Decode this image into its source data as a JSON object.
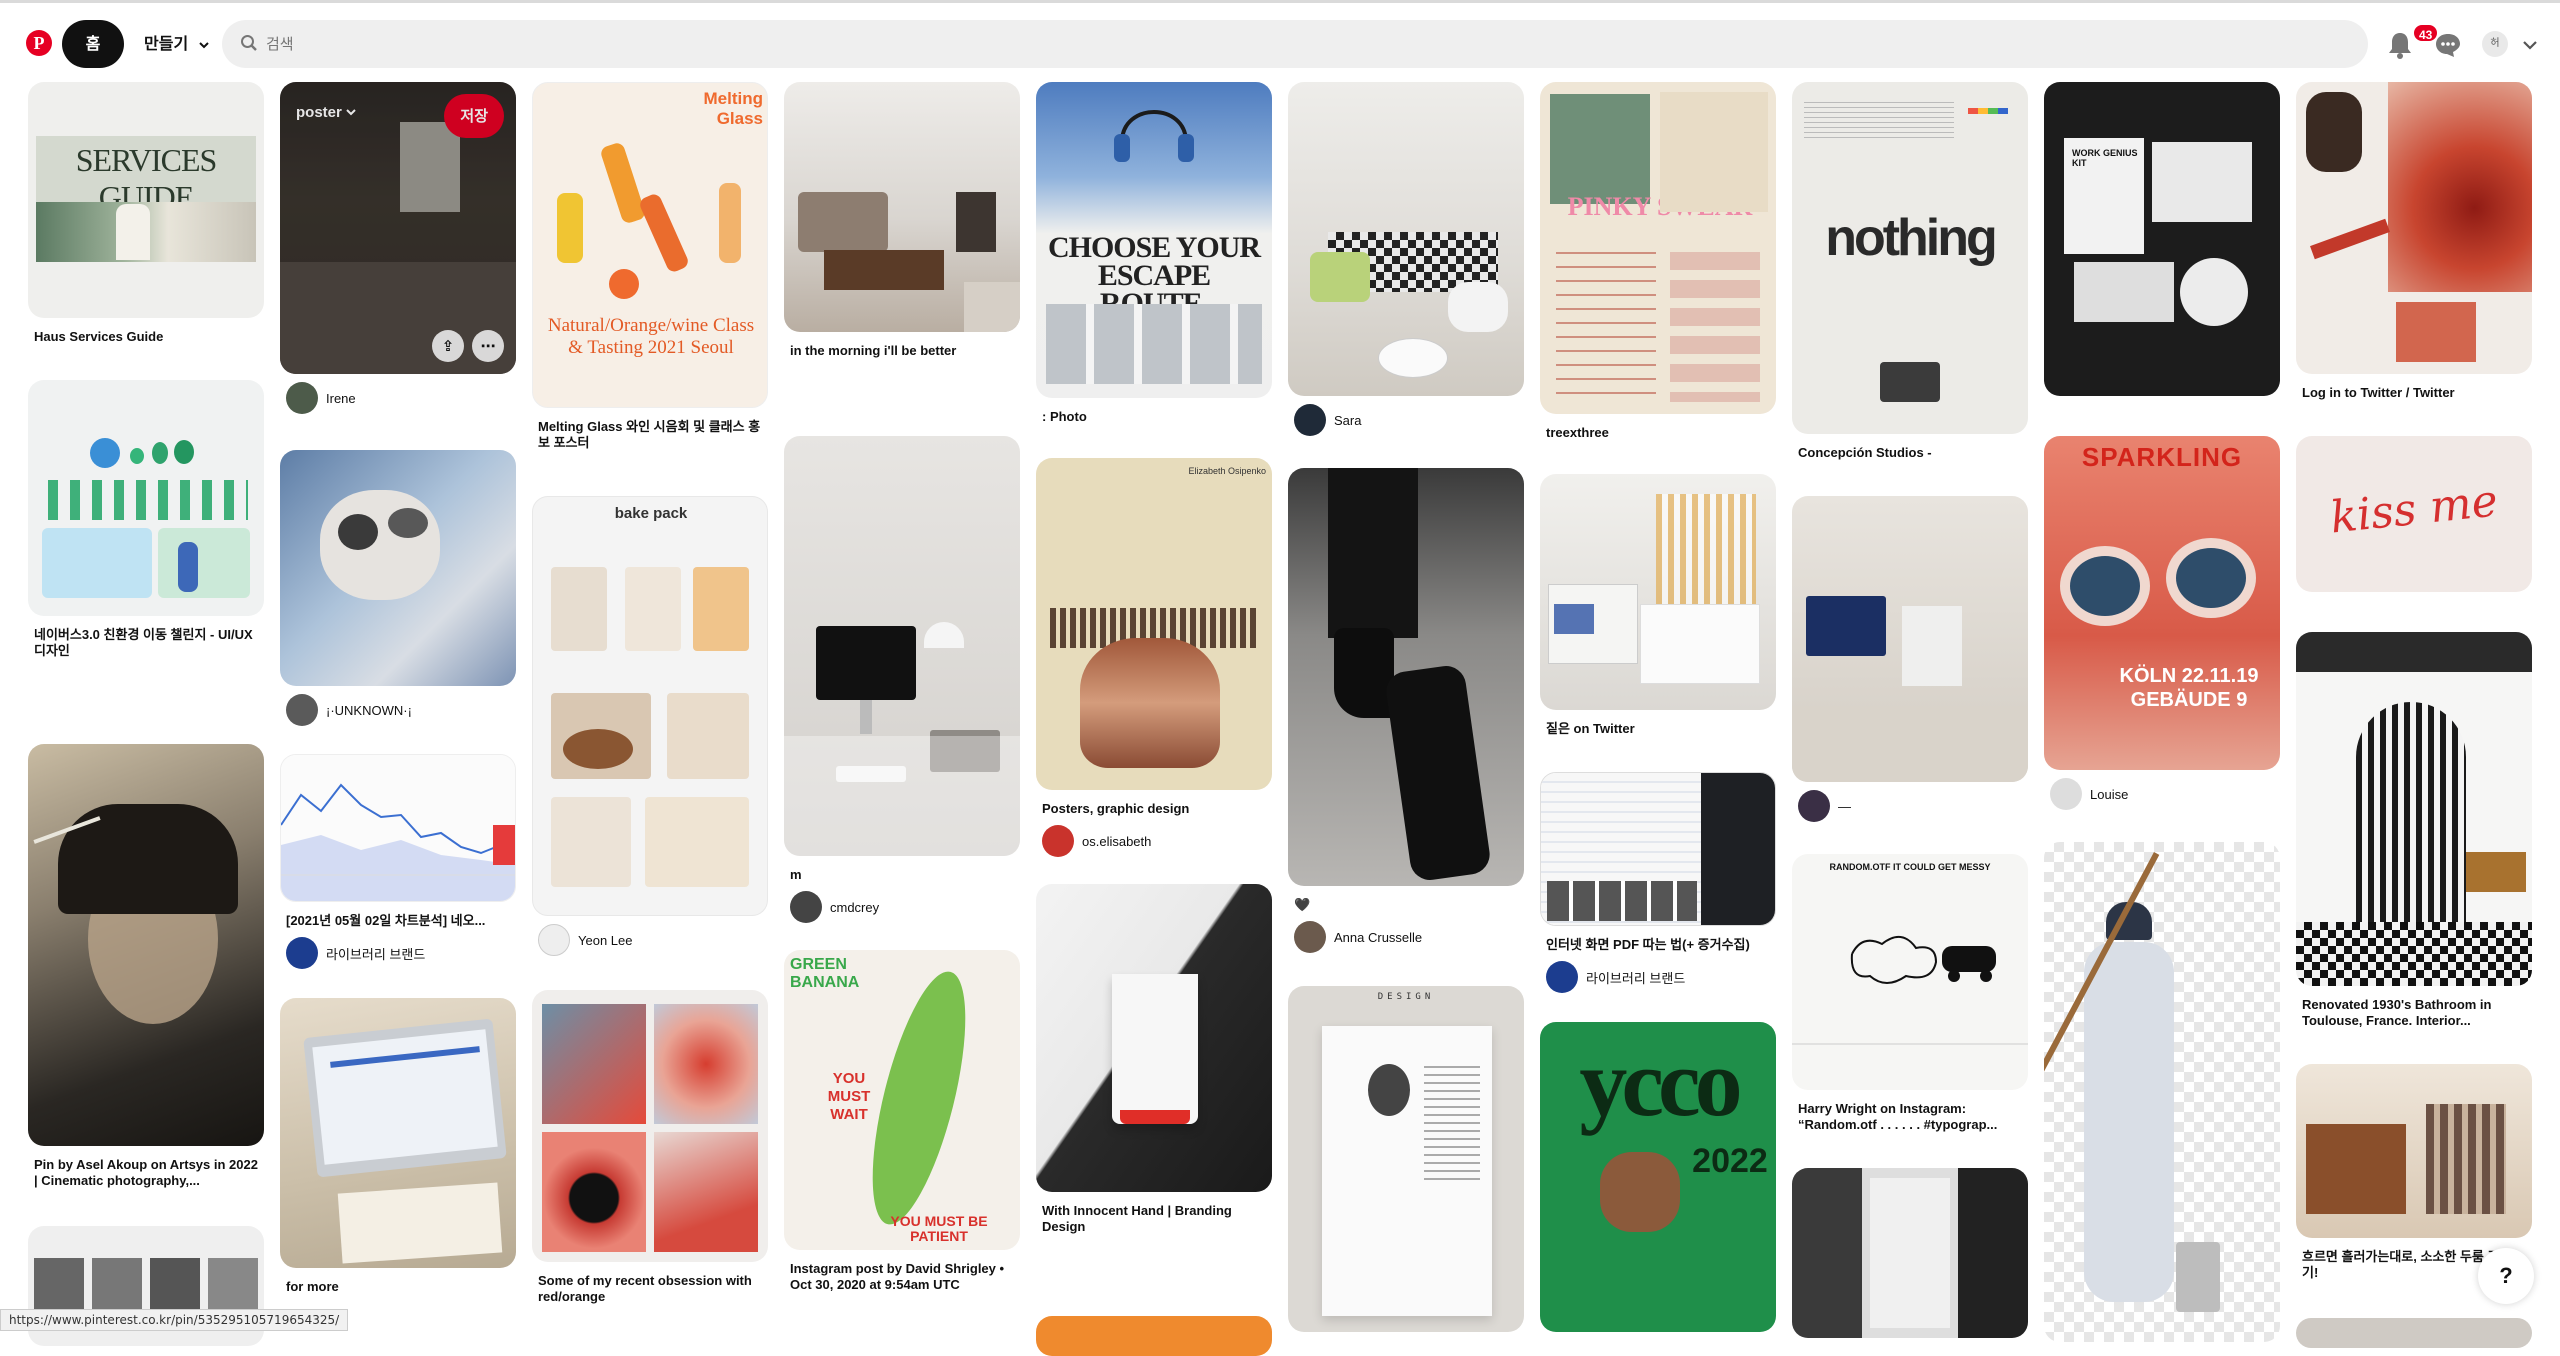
{
  "header": {
    "logo": "P",
    "home_label": "홈",
    "create_label": "만들기",
    "search_placeholder": "검색",
    "notification_count": "43",
    "user_initial": "허"
  },
  "status_url": "https://www.pinterest.co.kr/pin/535295105719654325/",
  "help_label": "?",
  "pins": {
    "c1p1": {
      "title": "Haus Services Guide",
      "image_text": "SERVICES GUIDE"
    },
    "c1p2": {
      "title": "네이버스3.0 친환경 이동 챌린지 - UI/UX 디자인"
    },
    "c1p3": {
      "title": "Pin by Asel Akoup on Artsys in 2022 | Cinematic photography,..."
    },
    "c2p1": {
      "board": "poster",
      "save": "저장",
      "author": "Irene"
    },
    "c2p2": {
      "author": "¡·UNKNOWN·¡"
    },
    "c2p3": {
      "title": "[2021년 05월 02일 차트분석] 네오...",
      "author": "라이브러리 브랜드"
    },
    "c2p4": {
      "title": "for more"
    },
    "c3p1": {
      "title": "Melting Glass 와인 시음회 및 클래스 홍보 포스터",
      "image_text": "Melting Glass",
      "image_text2": "Natural/Orange/wine Class & Tasting 2021 Seoul"
    },
    "c3p2": {
      "image_text": "bake pack",
      "author": "Yeon Lee"
    },
    "c3p3": {
      "title": "Some of my recent obsession with red/orange"
    },
    "c4p1": {
      "title": "in the morning i'll be better"
    },
    "c4p2": {
      "title": "m",
      "author": "cmdcrey"
    },
    "c4p3": {
      "title": "Instagram post by David Shrigley • Oct 30, 2020 at 9:54am UTC",
      "image_text": "GREEN BANANA",
      "image_text2": "YOU MUST WAIT",
      "image_text3": "YOU MUST BE PATIENT"
    },
    "c5p1": {
      "title": ": Photo",
      "image_text": "CHOOSE YOUR ESCAPE ROUTE."
    },
    "c5p2": {
      "title": "Posters, graphic design",
      "author": "os.elisabeth",
      "image_text": "Elizabeth Osipenko"
    },
    "c5p3": {
      "title": "With Innocent Hand | Branding Design"
    },
    "c6p1": {
      "author": "Sara"
    },
    "c6p2": {
      "title": "🖤",
      "author": "Anna Crusselle"
    },
    "c6p3": {
      "image_text": "DESIGN"
    },
    "c7p1": {
      "title": "treexthree",
      "image_text": "PINKY SWEAR"
    },
    "c7p2": {
      "title": "짙은 on Twitter"
    },
    "c7p3": {
      "title": "인터넷 화면 PDF 따는 법(+ 증거수집)",
      "author": "라이브러리 브랜드"
    },
    "c7p4": {
      "image_text": "2022"
    },
    "c8p1": {
      "title": "Concepción Studios -",
      "image_text": "nothing"
    },
    "c8p2": {
      "author": "—"
    },
    "c8p3": {
      "title": "Harry Wright on Instagram: “Random.otf . . . . . . #typograp...",
      "image_text": "RANDOM.OTF IT COULD GET MESSY"
    },
    "c9p1": {
      "image_text": "WORK GENIUS KIT"
    },
    "c9p2": {
      "author": "Louise",
      "image_text": "SPARKLING",
      "image_text2": "KÖLN 22.11.19 GEBÄUDE 9"
    },
    "c10p1": {
      "title": "Log in to Twitter / Twitter"
    },
    "c10p2": {
      "image_text": "kiss me"
    },
    "c10p3": {
      "title": "Renovated 1930's Bathroom in Toulouse, France. Interior..."
    },
    "c10p4": {
      "title": "흐르면 흘러가는대로, 소소한 두룸 꾸미기!"
    }
  }
}
